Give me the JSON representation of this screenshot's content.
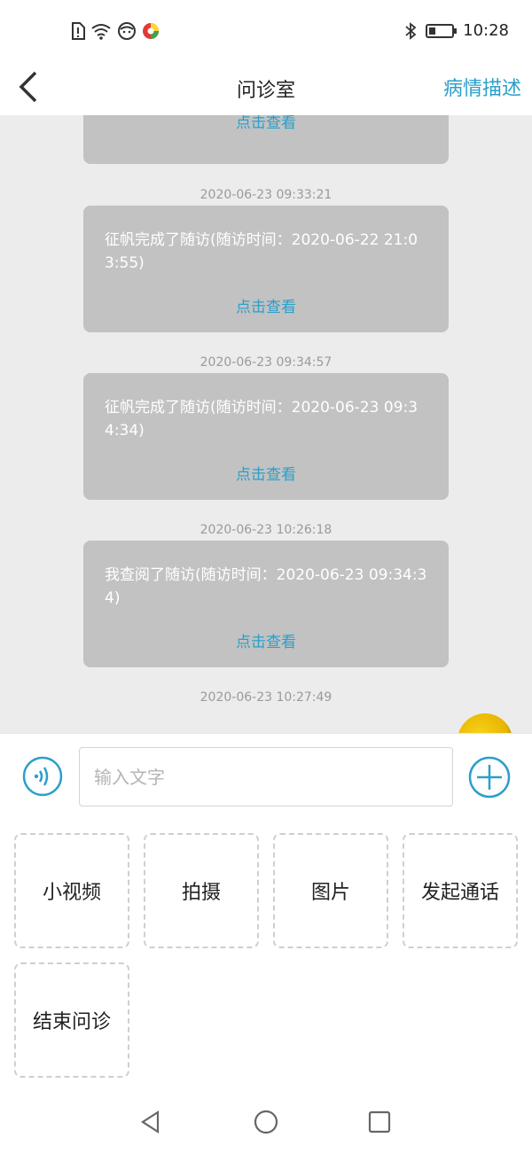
{
  "status_bar": {
    "time": "10:28",
    "icons": [
      "sim-alert-icon",
      "wifi-icon",
      "face-icon",
      "app-color-icon",
      "bluetooth-icon",
      "battery-icon"
    ],
    "battery_level": 0.3
  },
  "nav": {
    "title": "问诊室",
    "action_label": "病情描述",
    "back_icon": "chevron-left-icon"
  },
  "chat": {
    "first_link": "点击查看",
    "messages": [
      {
        "timestamp": "2020-06-23 09:33:21",
        "text": "征帆完成了随访(随访时间：2020-06-22 21:03:55)",
        "link": "点击查看"
      },
      {
        "timestamp": "2020-06-23 09:34:57",
        "text": "征帆完成了随访(随访时间：2020-06-23 09:34:34)",
        "link": "点击查看"
      },
      {
        "timestamp": "2020-06-23 10:26:18",
        "text": "我查阅了随访(随访时间：2020-06-23 09:34:34)",
        "link": "点击查看"
      }
    ],
    "last_timestamp": "2020-06-23 10:27:49"
  },
  "input": {
    "placeholder": "输入文字",
    "value": ""
  },
  "tiles": [
    {
      "label": "小视频"
    },
    {
      "label": "拍摄"
    },
    {
      "label": "图片"
    },
    {
      "label": "发起通话"
    },
    {
      "label": "结束问诊"
    }
  ],
  "colors": {
    "accent": "#2b9fc9",
    "bubble": "#c2c2c2",
    "chat_bg": "#ececec"
  }
}
